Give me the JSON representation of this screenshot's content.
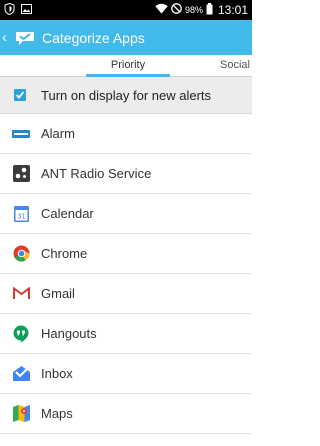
{
  "status_bar": {
    "battery": "98%",
    "time": "13:01"
  },
  "app_bar": {
    "title": "Categorize Apps"
  },
  "tabs": [
    {
      "label": "Priority",
      "selected": true
    },
    {
      "label": "Social",
      "selected": false
    }
  ],
  "toggle": {
    "label": "Turn on display for new alerts",
    "checked": true
  },
  "apps": [
    {
      "label": "Alarm",
      "icon": "alarm-icon"
    },
    {
      "label": "ANT Radio Service",
      "icon": "ant-radio-icon"
    },
    {
      "label": "Calendar",
      "icon": "calendar-icon"
    },
    {
      "label": "Chrome",
      "icon": "chrome-icon"
    },
    {
      "label": "Gmail",
      "icon": "gmail-icon"
    },
    {
      "label": "Hangouts",
      "icon": "hangouts-icon"
    },
    {
      "label": "Inbox",
      "icon": "inbox-icon"
    },
    {
      "label": "Maps",
      "icon": "maps-icon"
    }
  ],
  "colors": {
    "accent": "#41b9e9",
    "status_bar": "#000000",
    "toggle_row_bg": "#ececec"
  }
}
